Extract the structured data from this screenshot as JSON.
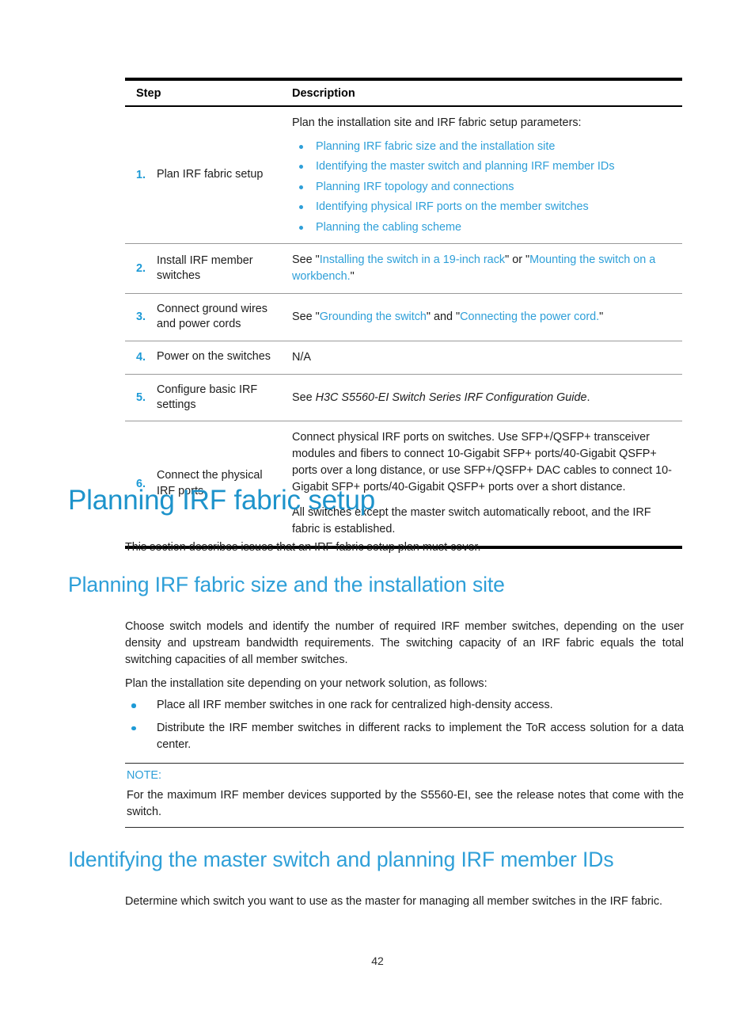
{
  "colors": {
    "link": "#2e9fd8",
    "heading1": "#1d93cb",
    "heading2": "#2e9fd8",
    "step_number": "#1d9ad6",
    "bullet": "#1d9ad6",
    "text": "#1d1d1d",
    "rule": "#000000"
  },
  "table": {
    "headers": {
      "step": "Step",
      "description": "Description"
    },
    "rows": [
      {
        "num": "1.",
        "label": "Plan IRF fabric setup",
        "intro": "Plan the installation site and IRF fabric setup parameters:",
        "links": [
          "Planning IRF fabric size and the installation site",
          "Identifying the master switch and planning IRF member IDs",
          "Planning IRF topology and connections",
          "Identifying physical IRF ports on the member switches",
          "Planning the cabling scheme"
        ]
      },
      {
        "num": "2.",
        "label": "Install IRF member switches",
        "desc_pre": "See \"",
        "desc_link1": "Installing the switch in a 19-inch rack",
        "desc_mid": "\" or \"",
        "desc_link2": "Mounting the switch on a workbench.",
        "desc_post": "\""
      },
      {
        "num": "3.",
        "label": "Connect ground wires and power cords",
        "desc_pre": "See \"",
        "desc_link1": "Grounding the switch",
        "desc_mid": "\" and \"",
        "desc_link2": "Connecting the power cord.",
        "desc_post": "\""
      },
      {
        "num": "4.",
        "label": "Power on the switches",
        "desc": "N/A"
      },
      {
        "num": "5.",
        "label": "Configure basic IRF settings",
        "desc_pre": "See ",
        "desc_italic": "H3C S5560-EI Switch Series IRF Configuration Guide",
        "desc_post": "."
      },
      {
        "num": "6.",
        "label": "Connect the physical IRF ports",
        "para1": "Connect physical IRF ports on switches. Use SFP+/QSFP+ transceiver modules and fibers to connect 10-Gigabit SFP+ ports/40-Gigabit QSFP+ ports over a long distance, or use SFP+/QSFP+ DAC cables to connect 10-Gigabit SFP+ ports/40-Gigabit QSFP+ ports over a short distance.",
        "para2": "All switches except the master switch automatically reboot, and the IRF fabric is established."
      }
    ]
  },
  "sections": {
    "h1_planning_irf_fabric_setup": "Planning IRF fabric setup",
    "intro_paragraph": "This section describes issues that an IRF fabric setup plan must cover.",
    "h2_planning_size": "Planning IRF fabric size and the installation site",
    "size_para1": "Choose switch models and identify the number of required IRF member switches, depending on the user density and upstream bandwidth requirements. The switching capacity of an IRF fabric equals the total switching capacities of all member switches.",
    "size_para2": "Plan the installation site depending on your network solution, as follows:",
    "size_bullets": [
      "Place all IRF member switches in one rack for centralized high-density access.",
      "Distribute the IRF member switches in different racks to implement the ToR access solution for a data center."
    ],
    "note": {
      "title": "NOTE:",
      "body": "For the maximum IRF member devices supported by the S5560-EI, see the release notes that come with the switch."
    },
    "h2_identifying_master": "Identifying the master switch and planning IRF member IDs",
    "identifying_para": "Determine which switch you want to use as the master for managing all member switches in the IRF fabric."
  },
  "footer": {
    "page_number": "42"
  }
}
